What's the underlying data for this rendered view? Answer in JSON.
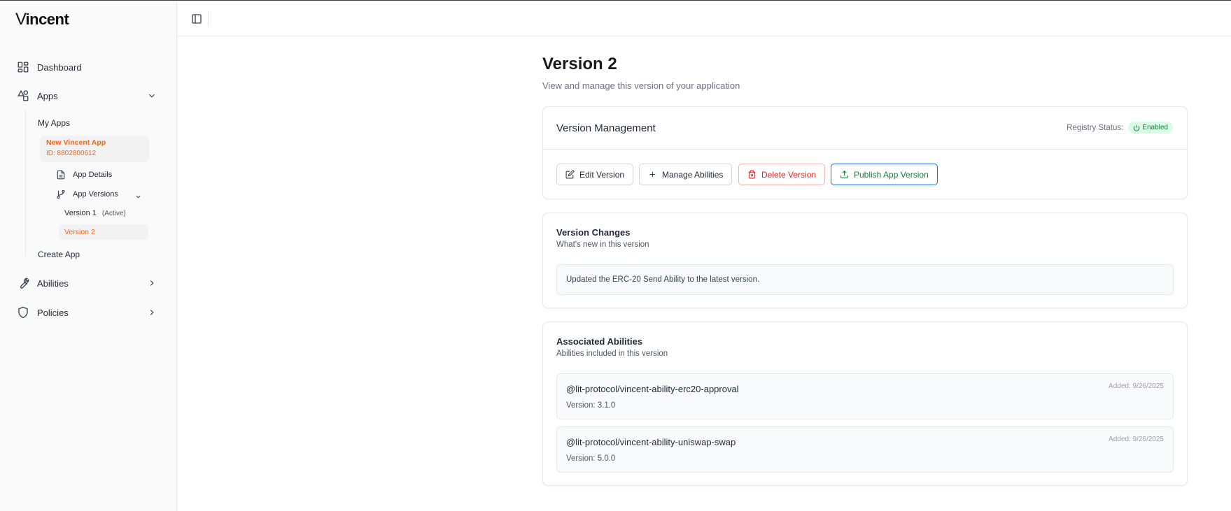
{
  "brand": {
    "logo_v": "V",
    "logo_rest": "incent"
  },
  "sidebar": {
    "dashboard": "Dashboard",
    "apps": "Apps",
    "my_apps": "My Apps",
    "app_card": {
      "name": "New Vincent App",
      "id": "ID: 8802800612"
    },
    "app_details": "App Details",
    "app_versions": "App Versions",
    "version1": "Version 1",
    "version1_status": "(Active)",
    "version2": "Version 2",
    "create_app": "Create App",
    "abilities": "Abilities",
    "policies": "Policies"
  },
  "page": {
    "title": "Version 2",
    "subtitle": "View and manage this version of your application"
  },
  "version_management": {
    "title": "Version Management",
    "registry_label": "Registry Status:",
    "registry_status": "Enabled",
    "buttons": {
      "edit": "Edit Version",
      "manage": "Manage Abilities",
      "delete": "Delete Version",
      "publish": "Publish App Version"
    }
  },
  "version_changes": {
    "title": "Version Changes",
    "desc": "What's new in this version",
    "text": "Updated the ERC-20 Send Ability to the latest version."
  },
  "associated_abilities": {
    "title": "Associated Abilities",
    "desc": "Abilities included in this version",
    "items": [
      {
        "name": "@lit-protocol/vincent-ability-erc20-approval",
        "version": "Version: 3.1.0",
        "added": "Added: 9/26/2025"
      },
      {
        "name": "@lit-protocol/vincent-ability-uniswap-swap",
        "version": "Version: 5.0.0",
        "added": "Added: 9/26/2025"
      }
    ]
  },
  "colors": {
    "accent_orange": "#f0681e",
    "enabled_green": "#15803d",
    "danger_red": "#dc2626",
    "publish_blue": "#2563eb"
  }
}
